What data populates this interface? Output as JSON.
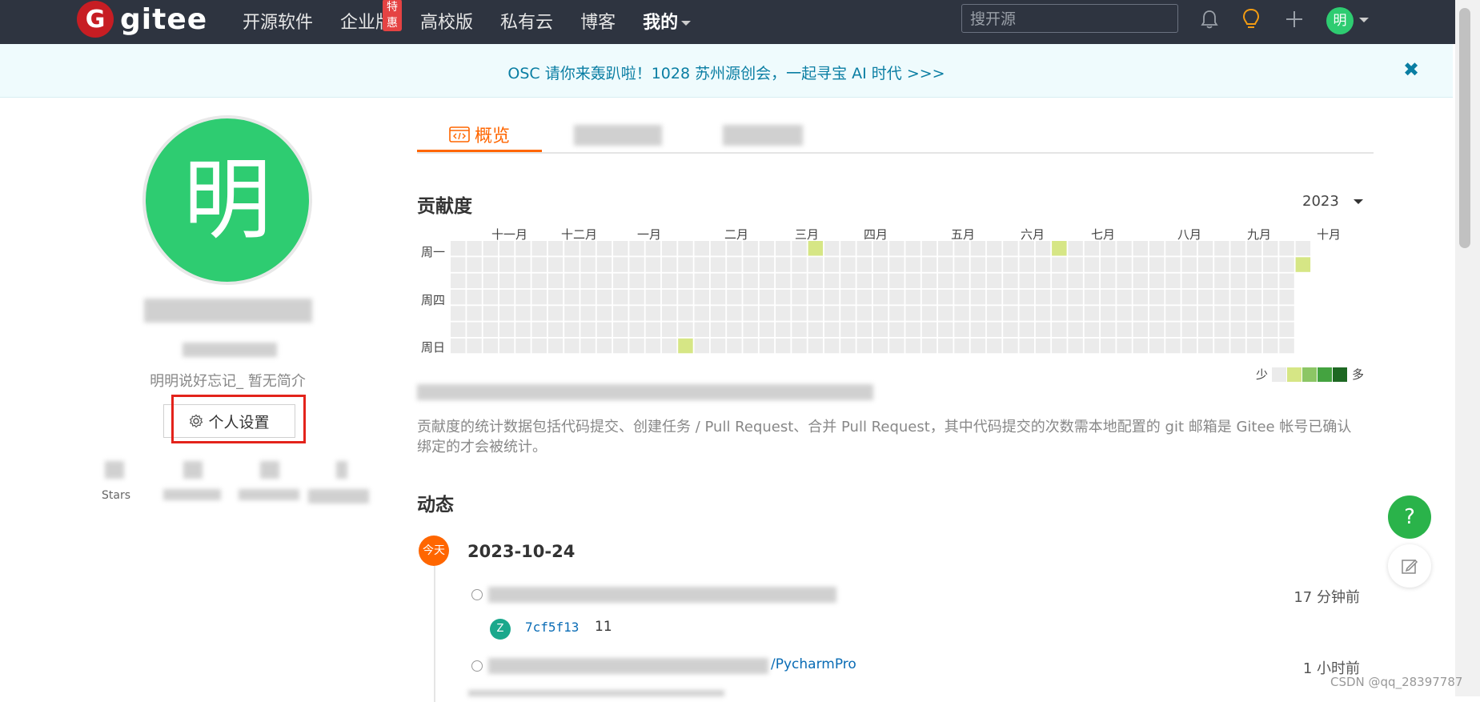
{
  "nav": {
    "logo_mark": "G",
    "logo_text": "gitee",
    "links": [
      {
        "label": "开源软件"
      },
      {
        "label": "企业版",
        "badge": "特惠"
      },
      {
        "label": "高校版"
      },
      {
        "label": "私有云"
      },
      {
        "label": "博客"
      },
      {
        "label": "我的"
      }
    ],
    "search_placeholder": "搜开源",
    "user_initial": "明"
  },
  "banner": {
    "text": "OSC 请你来轰趴啦！1028 苏州源创会，一起寻宝 AI 时代 >>>",
    "close": "✖"
  },
  "profile": {
    "avatar_initial": "明",
    "bio": "明明说好忘记_ 暂无简介",
    "settings_button": "个人设置",
    "stats_label": "Stars"
  },
  "tabs": {
    "overview": "概览"
  },
  "contribution": {
    "title": "贡献度",
    "year": "2023",
    "months": [
      "十一月",
      "十二月",
      "一月",
      "二月",
      "三月",
      "四月",
      "五月",
      "六月",
      "七月",
      "八月",
      "九月",
      "十月"
    ],
    "days": [
      "周一",
      "周四",
      "周日"
    ],
    "legend_less": "少",
    "legend_more": "多",
    "legend_colors": [
      "#ebebeb",
      "#d6e685",
      "#8cc665",
      "#44a340",
      "#1e6823"
    ],
    "description": "贡献度的统计数据包括代码提交、创建任务 / Pull Request、合并 Pull Request，其中代码提交的次数需本地配置的 git 邮箱是 Gitee 帐号已确认绑定的才会被统计。"
  },
  "activity": {
    "title": "动态",
    "today_badge": "今天",
    "date": "2023-10-24",
    "items": [
      {
        "ago": "17 分钟前",
        "commit_avatar": "Z",
        "commit_hash": "7cf5f13",
        "commit_msg": "11"
      },
      {
        "ago": "1 小时前",
        "link": "/PycharmPro"
      }
    ]
  },
  "fab": {
    "help": "?"
  },
  "watermark": "CSDN @qq_28397787"
}
